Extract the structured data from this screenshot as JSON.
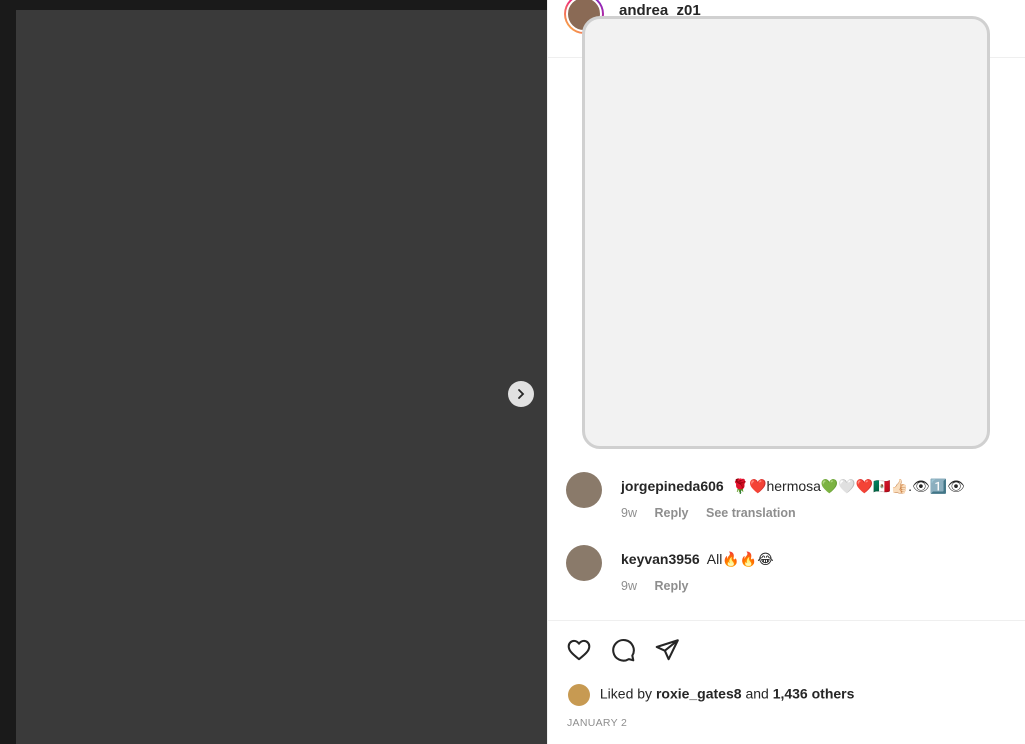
{
  "post": {
    "username": "andrea_z01",
    "date": "JANUARY 2"
  },
  "comments": [
    {
      "username": "jorgepineda606",
      "text": "🌹❤️hermosa💚🤍❤️🇲🇽👍🏻.👁1️⃣👁",
      "age": "9w",
      "reply": "Reply",
      "translate": "See translation"
    },
    {
      "username": "keyvan3956",
      "text": "All🔥🔥😂",
      "age": "9w",
      "reply": "Reply"
    }
  ],
  "likes": {
    "prefix": "Liked by",
    "user": "roxie_gates8",
    "connector": "and",
    "others": "1,436 others"
  },
  "icons": [
    "chevron-right-icon",
    "heart-icon",
    "comment-icon",
    "share-icon"
  ]
}
